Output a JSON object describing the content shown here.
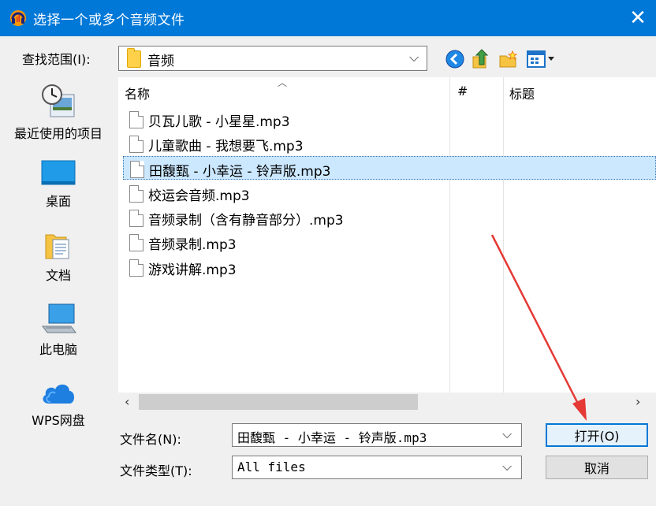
{
  "window": {
    "title": "选择一个或多个音频文件",
    "close_glyph": "✕"
  },
  "toolbar": {
    "lookin_label": "查找范围(I):",
    "lookin_value": "音频"
  },
  "places": [
    {
      "label": "最近使用的项目",
      "icon": "recent-items-icon"
    },
    {
      "label": "桌面",
      "icon": "desktop-icon"
    },
    {
      "label": "文档",
      "icon": "documents-icon"
    },
    {
      "label": "此电脑",
      "icon": "this-pc-icon"
    },
    {
      "label": "WPS网盘",
      "icon": "wps-cloud-icon"
    }
  ],
  "columns": {
    "name": "名称",
    "number": "#",
    "title": "标题"
  },
  "files": [
    {
      "name": "贝瓦儿歌 - 小星星.mp3",
      "selected": false
    },
    {
      "name": "儿童歌曲 - 我想要飞.mp3",
      "selected": false
    },
    {
      "name": "田馥甄 - 小幸运 - 铃声版.mp3",
      "selected": true
    },
    {
      "name": "校运会音频.mp3",
      "selected": false
    },
    {
      "name": "音频录制（含有静音部分）.mp3",
      "selected": false
    },
    {
      "name": "音频录制.mp3",
      "selected": false
    },
    {
      "name": "游戏讲解.mp3",
      "selected": false
    }
  ],
  "form": {
    "filename_label": "文件名(N):",
    "filename_value": "田馥甄 - 小幸运 - 铃声版.mp3",
    "filetype_label": "文件类型(T):",
    "filetype_value": "All files"
  },
  "buttons": {
    "open": "打开(O)",
    "cancel": "取消"
  },
  "colors": {
    "titlebar": "#0078d7",
    "selection": "#cce8ff",
    "annotation_arrow": "#e53935"
  }
}
